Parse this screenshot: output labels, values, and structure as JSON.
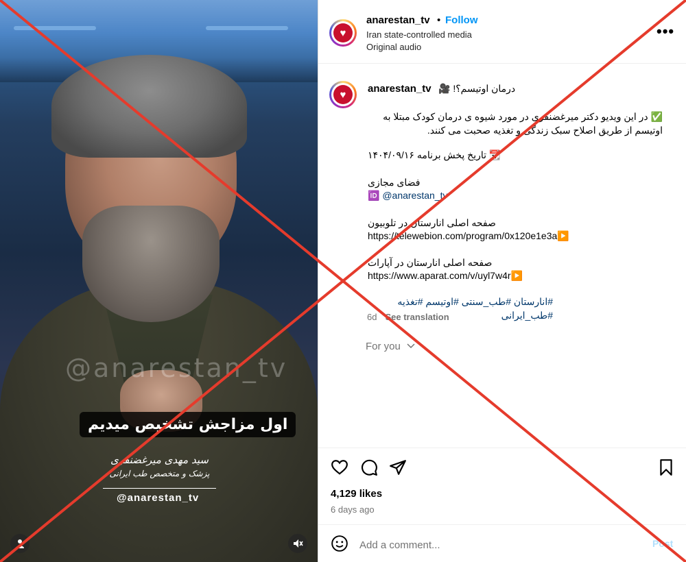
{
  "video": {
    "watermark": "@anarestan_tv",
    "caption": "اول مزاجش تشخیص میدیم",
    "name_line1": "سید مهدی میرغضنفری",
    "name_line2": "پزشک و متخصص طب ایرانی",
    "handle": "@anarestan_tv",
    "user_icon": "person-icon",
    "mute_icon": "speaker-muted-icon"
  },
  "header": {
    "username": "anarestan_tv",
    "separator": "•",
    "follow_label": "Follow",
    "label_line": "Iran state-controlled media",
    "audio_line": "Original audio",
    "more_icon": "•••"
  },
  "caption": {
    "username": "anarestan_tv",
    "title": "درمان اوتیسم؟! 🎥",
    "description": "✅ در این ویدیو دکتر میرغضنفری در مورد شیوه ی درمان کودک مبتلا به اوتیسم از طریق اصلاح سبک زندگی و تغذیه صحبت می کنند.",
    "air_date": "📆 تاریخ پخش برنامه ۱۴۰۴/۰۹/۱۶",
    "cyberspace_label": "فضای مجازی",
    "id_handle": "🆔 @anarestan_tv",
    "telewebion_label": "صفحه اصلی انارستان در تلوبیون",
    "telewebion_url": "https://telewebion.com/program/0x120e1e3a▶️",
    "aparat_label": "صفحه اصلی انارستان در آپارات",
    "aparat_url": "https://www.aparat.com/v/uyl7w4r▶️",
    "hashtags": "#انارستان #طب_سنتی #اوتیسم #تغذیه #طب_ایرانی",
    "age": "6d",
    "see_translation": "See translation"
  },
  "for_you": "For you",
  "actions": {
    "like_icon": "heart-icon",
    "comment_icon": "comment-icon",
    "share_icon": "send-icon",
    "save_icon": "bookmark-icon"
  },
  "likes": "4,129 likes",
  "posted": "6 days ago",
  "comment": {
    "placeholder": "Add a comment...",
    "value": "",
    "post_label": "Post",
    "emoji_icon": "smiley-icon"
  },
  "colors": {
    "follow_blue": "#0095f6",
    "link_blue": "#00376b",
    "overlay_red": "#e53b2c",
    "avatar_red": "#c8102e"
  }
}
